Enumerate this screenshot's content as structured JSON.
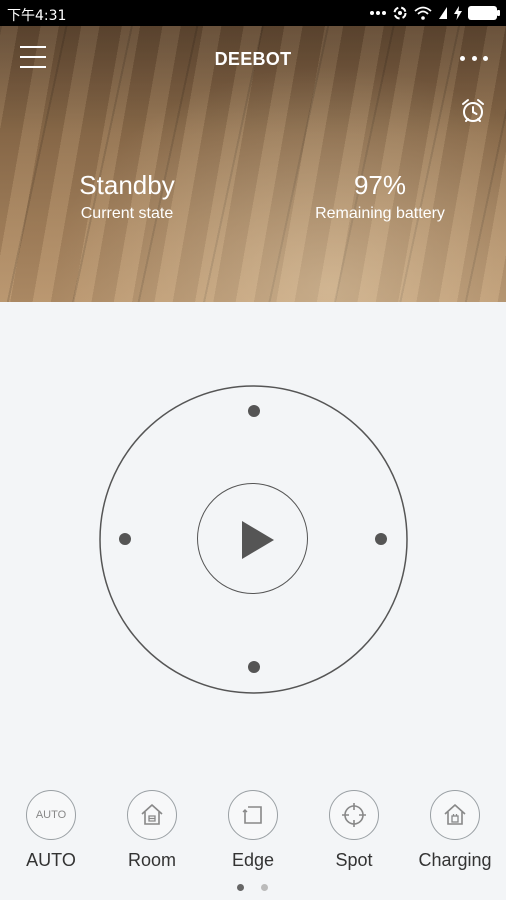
{
  "status_bar": {
    "time": "下午4:31",
    "battery_color": "#ffffff"
  },
  "header": {
    "title": "DEEBOT"
  },
  "state": {
    "value": "Standby",
    "label": "Current state"
  },
  "battery": {
    "value": "97%",
    "label": "Remaining battery"
  },
  "modes": [
    {
      "key": "auto",
      "icon_text": "AUTO",
      "label": "AUTO"
    },
    {
      "key": "room",
      "label": "Room",
      "icon": "room-icon"
    },
    {
      "key": "edge",
      "label": "Edge",
      "icon": "edge-icon"
    },
    {
      "key": "spot",
      "label": "Spot",
      "icon": "spot-icon"
    },
    {
      "key": "charging",
      "label": "Charging",
      "icon": "charging-home-icon"
    }
  ],
  "pager": {
    "pages": 2,
    "active": 1
  },
  "colors": {
    "control": "#555555",
    "background": "#f3f5f7",
    "pager_active": "#666666",
    "pager_inactive": "#bbbbbb"
  }
}
